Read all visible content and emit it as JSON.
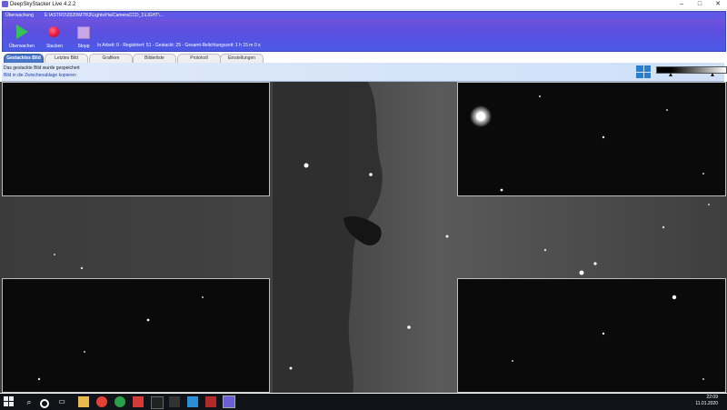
{
  "window": {
    "title": "DeepSkyStacker Live 4.2.2",
    "min_glyph": "–",
    "max_glyph": "□",
    "close_glyph": "✕"
  },
  "toolbar": {
    "monitoring_label": "Überwachung",
    "monitoring_path": "E:\\ASTRO\\2020\\M78\\3\\Lights\\Ha\\CameraCCD_1\\LIGHT\\...",
    "buttons": [
      {
        "label": "Überwachen",
        "icon": "play-icon"
      },
      {
        "label": "Stacken",
        "icon": "record-icon"
      },
      {
        "label": "Stopp",
        "icon": "stop-icon"
      }
    ],
    "status": "In Arbeit: 0 - Registriert: 51 - Gestackt: 25 - Gesamt-Belichtungszeit: 1 h 15 m 0 s"
  },
  "tabs": [
    {
      "label": "Gestacktes Bild",
      "active": true
    },
    {
      "label": "Letztes Bild",
      "active": false
    },
    {
      "label": "Grafiken",
      "active": false
    },
    {
      "label": "Bilderliste",
      "active": false
    },
    {
      "label": "Protokoll",
      "active": false
    },
    {
      "label": "Einstellungen",
      "active": false
    }
  ],
  "info": {
    "message": "Das gestackte Bild wurde gespeichert",
    "copy_link": "Bild in die Zwischenablage kopieren"
  },
  "taskbar": {
    "time": "22:09",
    "date": "11.01.2020",
    "apps": [
      "file-explorer-icon",
      "chrome-icon",
      "edge-icon",
      "app-icon",
      "terminal-icon",
      "app-icon",
      "app-icon",
      "app-icon",
      "deepskystacker-icon"
    ]
  },
  "colors": {
    "accent": "#5a4fe0",
    "active_tab": "#4a76c8",
    "link": "#1c3fa6"
  }
}
